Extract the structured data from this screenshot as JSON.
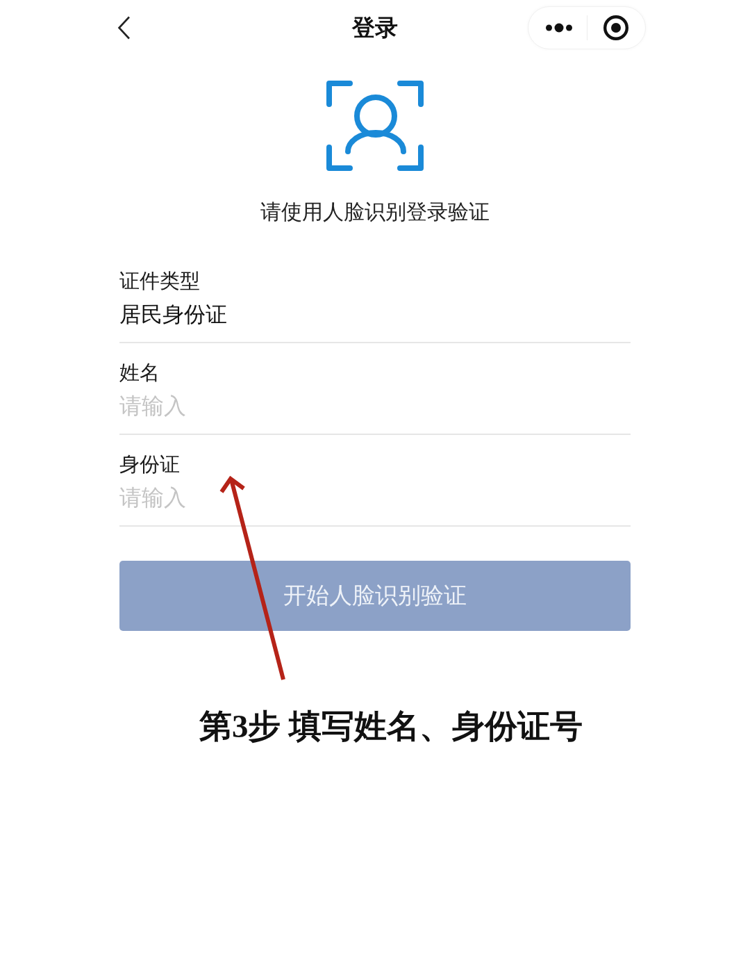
{
  "header": {
    "title": "登录"
  },
  "face_prompt": "请使用人脸识别登录验证",
  "fields": [
    {
      "kind": "select",
      "label": "证件类型",
      "value": "居民身份证"
    },
    {
      "kind": "input",
      "label": "姓名",
      "placeholder": "请输入"
    },
    {
      "kind": "input",
      "label": "身份证",
      "placeholder": "请输入"
    }
  ],
  "submit_button": {
    "label": "开始人脸识别验证",
    "disabled": true
  },
  "annotation": {
    "caption": "第3步 填写姓名、身份证号"
  }
}
